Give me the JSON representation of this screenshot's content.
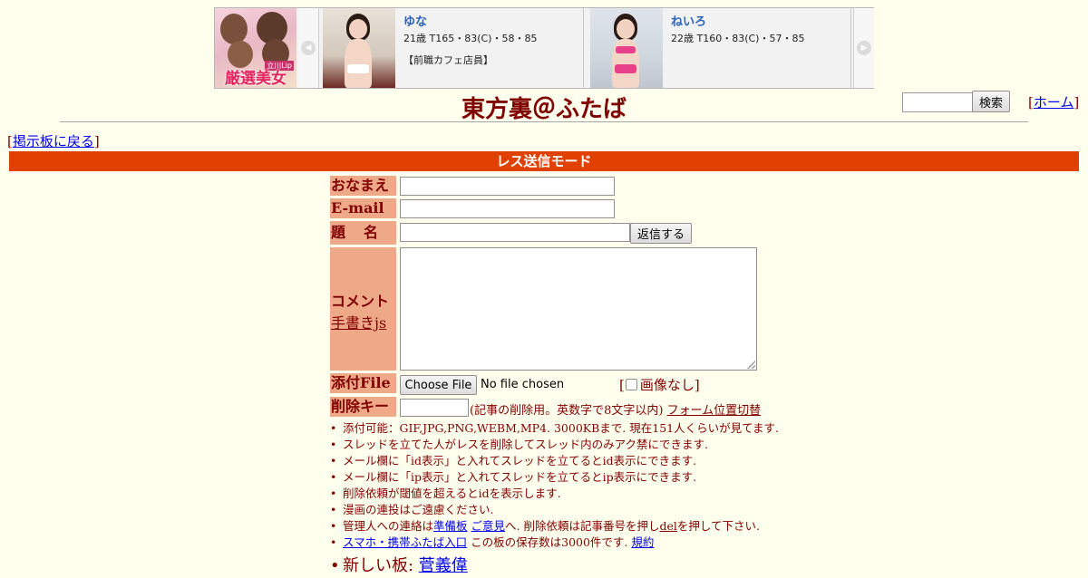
{
  "banner": {
    "promo": {
      "text": "厳選美女",
      "sub": "立川Lip"
    },
    "arrows": {
      "left": "◀",
      "right": "▶"
    },
    "cards": [
      {
        "name": "ゆな",
        "spec": "21歳 T165・83(C)・58・85",
        "note": "【前職カフェ店員】"
      },
      {
        "name": "ねいろ",
        "spec": "22歳 T160・83(C)・57・85",
        "note": ""
      }
    ]
  },
  "header": {
    "title": "東方裏＠ふたば",
    "search_button": "検索",
    "home_open": "[",
    "home_link": "ホーム",
    "home_close": "]"
  },
  "back": {
    "open": "[",
    "link": "掲示板に戻る",
    "close": "]"
  },
  "mode_bar": "レス送信モード",
  "form": {
    "name_label": "おなまえ",
    "email_label": "E-mail",
    "subject_label": "題名",
    "reply_button": "返信する",
    "comment_label": "コメント",
    "handwriting_link": "手書きjs",
    "file_label": "添付File",
    "file_button": "Choose File",
    "file_status": "No file chosen",
    "noimg_open": "[",
    "noimg_label": "画像なし",
    "noimg_close": "]",
    "delkey_label": "削除キー",
    "delkey_note": "(記事の削除用。英数字で8文字以内)",
    "form_switch_link": "フォーム位置切替"
  },
  "notes": {
    "n1": "添付可能：GIF,JPG,PNG,WEBM,MP4. 3000KBまで. 現在151人くらいが見てます.",
    "n2": "スレッドを立てた人がレスを削除してスレッド内のみアク禁にできます.",
    "n3": "メール欄に「id表示」と入れてスレッドを立てるとid表示にできます.",
    "n4": "メール欄に「ip表示」と入れてスレッドを立てるとip表示にできます.",
    "n5": "削除依頼が閾値を超えるとidを表示します.",
    "n6": "漫画の連投はご遠慮ください.",
    "n7_a": "管理人への連絡は",
    "n7_link1": "準備板",
    "n7_sp": " ",
    "n7_link2": "ご意見",
    "n7_b": "へ. 削除依頼は記事番号を押し",
    "n7_link3": "del",
    "n7_c": "を押して下さい.",
    "n8_link1": "スマホ・携帯ふたば入口",
    "n8_a": " この板の保存数は3000件です. ",
    "n8_link2": "規約",
    "n9_a": "新しい板: ",
    "n9_link": "菅義偉"
  }
}
